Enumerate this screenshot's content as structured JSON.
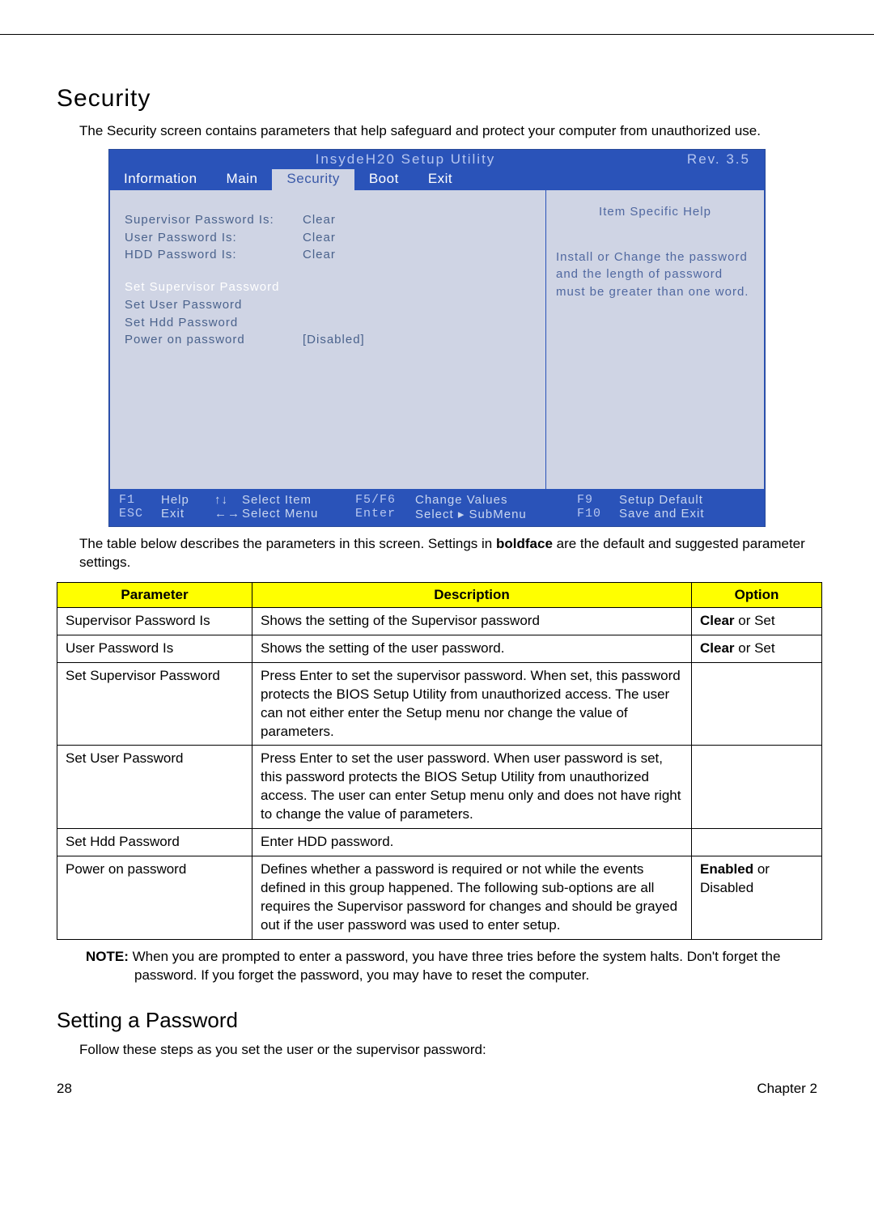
{
  "header": {
    "title": "Security"
  },
  "intro": "The Security screen contains parameters that help safeguard and protect your computer from unauthorized use.",
  "bios": {
    "title": "InsydeH20 Setup Utility",
    "rev": "Rev. 3.5",
    "tabs": [
      "Information",
      "Main",
      "Security",
      "Boot",
      "Exit"
    ],
    "fields": {
      "supervisor_label": "Supervisor Password Is:",
      "supervisor_value": "Clear",
      "user_label": "User Password Is:",
      "user_value": "Clear",
      "hdd_label": "HDD Password Is:",
      "hdd_value": "Clear",
      "set_supervisor": "Set Supervisor Password",
      "set_user": "Set User Password",
      "set_hdd": "Set Hdd Password",
      "power_on_label": "Power on password",
      "power_on_value": "[Disabled]"
    },
    "help": {
      "title": "Item Specific Help",
      "body": "Install or Change the password and the length of password must be greater than one word."
    },
    "footer": {
      "line1": {
        "k1": "F1",
        "t1": "Help",
        "s1": "↑↓",
        "t2": "Select Item",
        "k2": "F5/F6",
        "t3": "Change Values",
        "k3": "F9",
        "t4": "Setup Default"
      },
      "line2": {
        "k1": "ESC",
        "t1": "Exit",
        "s1": "←→",
        "t2": "Select Menu",
        "k2": "Enter",
        "t3": "Select ▸ SubMenu",
        "k3": "F10",
        "t4": "Save and Exit"
      }
    }
  },
  "table_intro_pre": "The table below describes the parameters in this screen. Settings in ",
  "table_intro_bold": "boldface",
  "table_intro_post": " are the default and suggested parameter settings.",
  "table": {
    "headers": [
      "Parameter",
      "Description",
      "Option"
    ],
    "rows": [
      {
        "param": "Supervisor Password Is",
        "desc": "Shows the setting of the Supervisor password",
        "opt_bold": "Clear",
        "opt_rest": " or Set"
      },
      {
        "param": "User Password Is",
        "desc": "Shows the setting of the user password.",
        "opt_bold": "Clear",
        "opt_rest": " or Set"
      },
      {
        "param": "Set Supervisor Password",
        "desc": "Press Enter to set the supervisor password. When set, this password protects the BIOS Setup Utility from unauthorized access. The user can not either enter the Setup menu nor change the value of parameters.",
        "opt_bold": "",
        "opt_rest": ""
      },
      {
        "param": "Set User Password",
        "desc": "Press Enter to set the user password. When user password is set, this password protects the BIOS Setup Utility from unauthorized access. The user can enter Setup menu only and does not have right to change the value of parameters.",
        "opt_bold": "",
        "opt_rest": ""
      },
      {
        "param": "Set Hdd Password",
        "desc": "Enter HDD password.",
        "opt_bold": "",
        "opt_rest": ""
      },
      {
        "param": "Power on password",
        "desc": "Defines whether a password is required or not while the events defined in this group happened. The following sub-options are all requires the Supervisor password for changes and should be grayed out if the user password was used to enter setup.",
        "opt_bold": "Enabled",
        "opt_rest": " or Disabled"
      }
    ]
  },
  "note_bold": "NOTE:",
  "note_body": " When you are prompted to enter a password, you have three tries before the system halts. Don't forget the password. If you forget the password, you may have to reset the computer.",
  "subheader": "Setting a Password",
  "sub_intro": "Follow these steps as you set the user or the supervisor password:",
  "footer": {
    "page": "28",
    "chapter": "Chapter 2"
  }
}
